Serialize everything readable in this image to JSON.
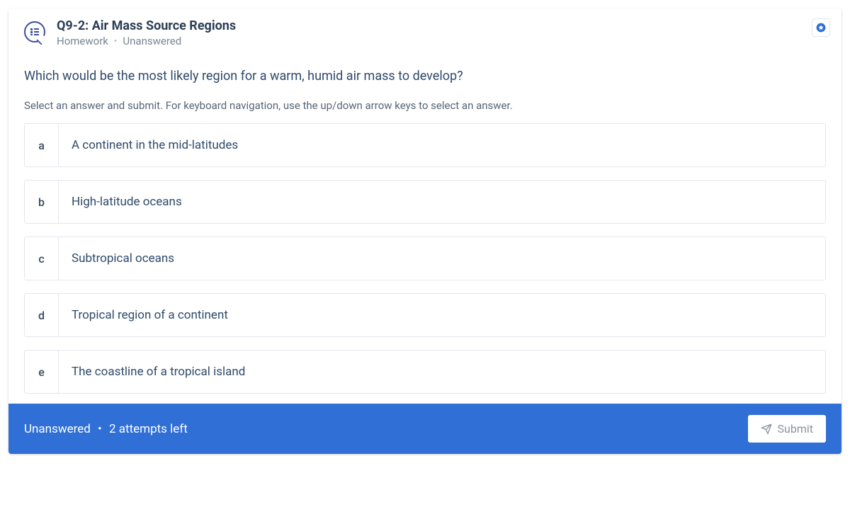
{
  "header": {
    "title": "Q9-2: Air Mass Source Regions",
    "category": "Homework",
    "status": "Unanswered"
  },
  "question": {
    "prompt": "Which would be the most likely region for a warm, humid air mass to develop?",
    "instructions": "Select an answer and submit. For keyboard navigation, use the up/down arrow keys to select an answer."
  },
  "options": [
    {
      "letter": "a",
      "text": "A continent in the mid-latitudes"
    },
    {
      "letter": "b",
      "text": "High-latitude oceans"
    },
    {
      "letter": "c",
      "text": "Subtropical oceans"
    },
    {
      "letter": "d",
      "text": "Tropical region of a continent"
    },
    {
      "letter": "e",
      "text": "The coastline of a tropical island"
    }
  ],
  "footer": {
    "status": "Unanswered",
    "attempts": "2 attempts left",
    "submit_label": "Submit"
  }
}
